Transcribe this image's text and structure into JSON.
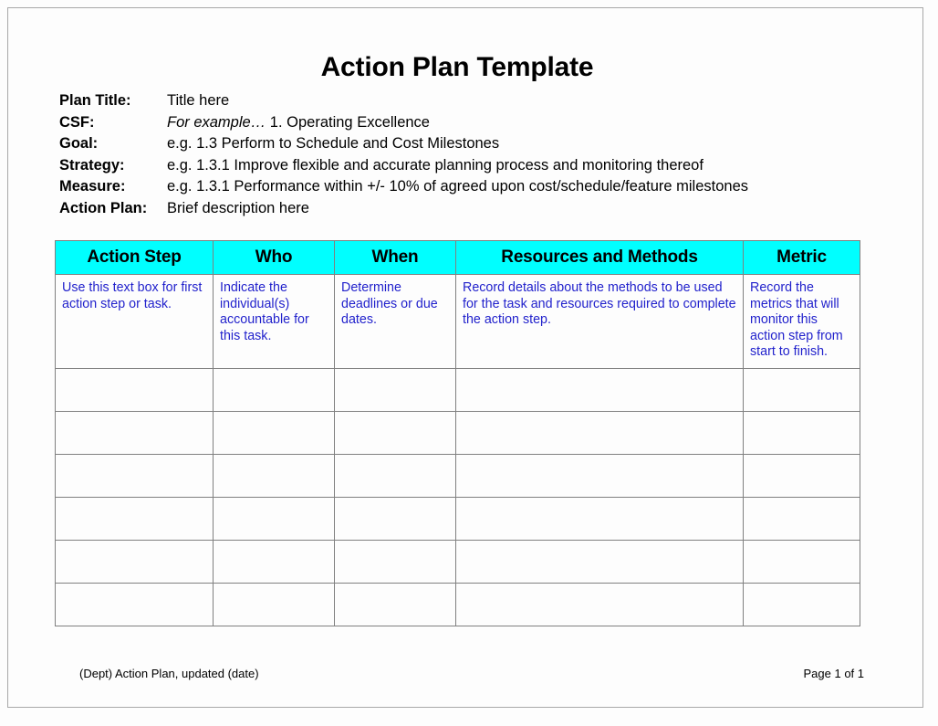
{
  "document": {
    "title": "Action Plan Template"
  },
  "meta": {
    "rows": [
      {
        "label": "Plan Title:",
        "value": "Title here",
        "italic_prefix": ""
      },
      {
        "label": "CSF:",
        "value": "1. Operating Excellence",
        "italic_prefix": "For example…"
      },
      {
        "label": "Goal:",
        "value": "e.g.  1.3  Perform to Schedule and Cost Milestones",
        "italic_prefix": ""
      },
      {
        "label": "Strategy:",
        "value": "e.g.  1.3.1  Improve flexible and accurate planning process and monitoring thereof",
        "italic_prefix": ""
      },
      {
        "label": "Measure:",
        "value": "e.g.  1.3.1  Performance within +/- 10% of agreed upon cost/schedule/feature milestones",
        "italic_prefix": ""
      },
      {
        "label": "Action Plan:",
        "value": "Brief description here",
        "italic_prefix": ""
      }
    ]
  },
  "table": {
    "header_background": "#00FFFF",
    "hint_text_color": "#2222CC",
    "columns": [
      "Action Step",
      "Who",
      "When",
      "Resources and Methods",
      "Metric"
    ],
    "hint_row": [
      "Use this text box for first action step or task.",
      "Indicate the individual(s) accountable for this task.",
      "Determine deadlines or due dates.",
      "Record details about the methods to be used for the task and resources required to complete the action step.",
      "Record the metrics that will monitor this action step from start to finish."
    ],
    "empty_row_count": 6
  },
  "footer": {
    "left": "(Dept) Action Plan, updated (date)",
    "right": "Page 1 of 1"
  }
}
